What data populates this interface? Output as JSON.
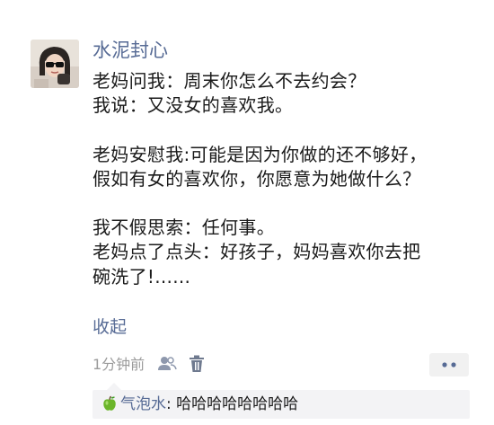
{
  "post": {
    "author": "水泥封心",
    "body_lines": [
      "老妈问我：周末你怎么不去约会？",
      "我说：又没女的喜欢我。",
      "",
      "老妈安慰我:可能是因为你做的还不够好，",
      "假如有女的喜欢你，你愿意为她做什么？",
      "",
      "我不假思索：任何事。",
      "老妈点了点头：好孩子，妈妈喜欢你去把",
      "碗洗了!......"
    ],
    "collapse_label": "收起",
    "time": "1分钟前"
  },
  "icons": {
    "avatar": "avatar-photo",
    "privacy": "people-icon",
    "delete": "trash-icon",
    "more": "more-dots-icon",
    "commenter_badge": "green-apple-icon"
  },
  "comment": {
    "name": "气泡水",
    "separator": ": ",
    "text": "哈哈哈哈哈哈哈哈"
  },
  "colors": {
    "link": "#576b95",
    "text": "#1a1a1a",
    "muted": "#9b9b9b",
    "comment_bg": "#f3f3f5"
  }
}
